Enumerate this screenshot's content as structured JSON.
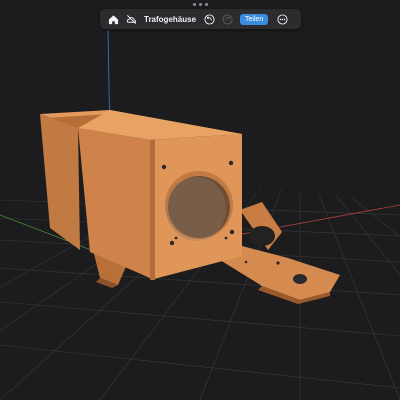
{
  "app": {
    "document_title": "Trafogehäuse",
    "share_label": "Teilen"
  },
  "toolbar": {
    "icons": [
      "home-icon",
      "hide-cloud-icon",
      "undo-icon",
      "redo-icon",
      "more-icon"
    ],
    "redo_enabled": false
  },
  "colors": {
    "background": "#1c1c1e",
    "toolbar": "#2c2c2e",
    "accent": "#3a8dde",
    "model_orange": "#d98b4e",
    "grid": "#3a3a3c"
  },
  "viewport": {
    "model": "3d-printed transformer housing",
    "grid": true
  }
}
